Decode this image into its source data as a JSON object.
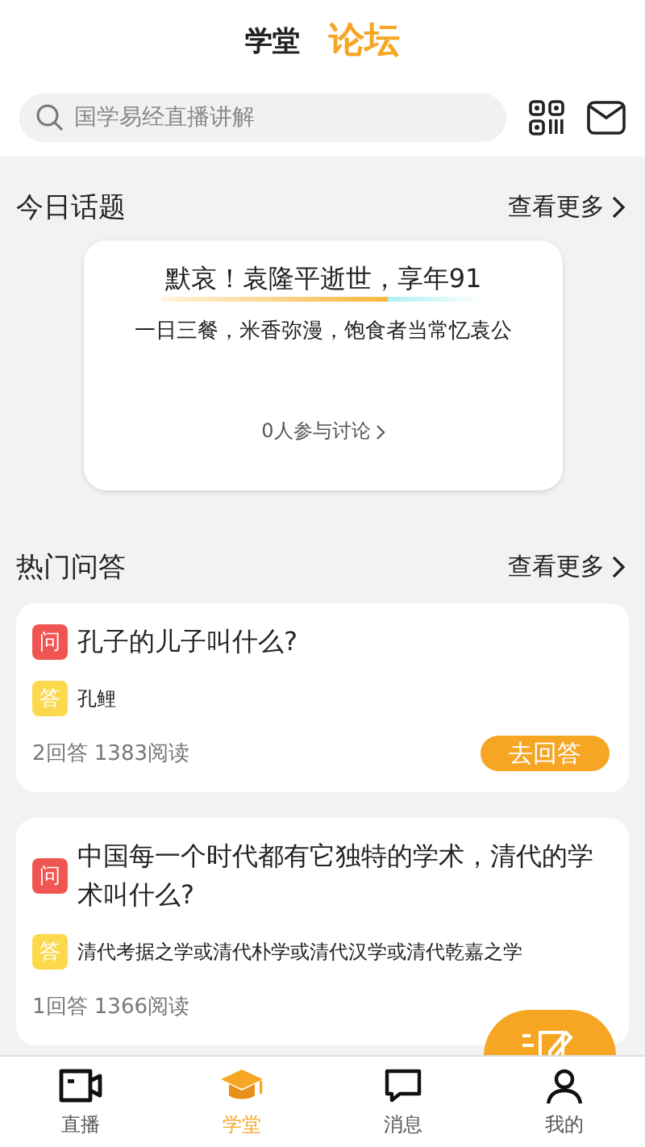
{
  "header": {
    "tabs": [
      {
        "label": "学堂",
        "selected": false
      },
      {
        "label": "论坛",
        "selected": true
      }
    ],
    "search": {
      "placeholder": "国学易经直播讲解"
    }
  },
  "today_topic": {
    "title": "今日话题",
    "more": "查看更多",
    "topic": {
      "headline": "默哀！袁隆平逝世，享年91",
      "summary": "一日三餐，米香弥漫，饱食者当常忆袁公",
      "participants": "0人参与讨论"
    }
  },
  "hot_qa": {
    "title": "热门问答",
    "more": "查看更多",
    "questions": [
      {
        "question_mark": "问",
        "question": "孔子的儿子叫什么?",
        "answer_mark": "答",
        "answer": "孔鲤",
        "stats": "2回答 1383阅读",
        "action": "去回答"
      },
      {
        "question_mark": "问",
        "question": "中国每一个时代都有它独特的学术，清代的学术叫什么?",
        "answer_mark": "答",
        "answer": "清代考据之学或清代朴学或清代汉学或清代乾嘉之学",
        "stats": "1回答 1366阅读"
      }
    ]
  },
  "bottom_nav": [
    {
      "kind": "video",
      "label": "直播",
      "selected": false
    },
    {
      "kind": "cap",
      "label": "学堂",
      "selected": true
    },
    {
      "kind": "chat",
      "label": "消息",
      "selected": false
    },
    {
      "kind": "person",
      "label": "我的",
      "selected": false
    }
  ]
}
